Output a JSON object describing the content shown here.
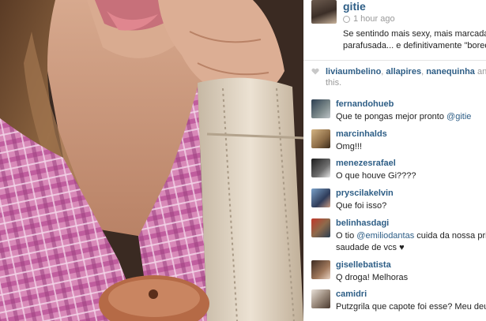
{
  "post": {
    "username": "gitie",
    "time": "1 hour ago",
    "caption_lines": [
      "Se sentindo mais sexy, mais marcada",
      "parafusada... e definitivamente \"bored"
    ]
  },
  "likes": {
    "users": [
      "liviaumbelino",
      "allapires",
      "nanequinha"
    ],
    "separators": [
      ", ",
      ", ",
      " and"
    ],
    "suffix": "this."
  },
  "comments": [
    {
      "username": "fernandohueb",
      "text": "Que te pongas mejor pronto ",
      "mention": "@gitie",
      "text_after": ""
    },
    {
      "username": "marcinhalds",
      "text": "Omg!!!",
      "mention": "",
      "text_after": ""
    },
    {
      "username": "menezesrafael",
      "text": "O que houve Gi????",
      "mention": "",
      "text_after": ""
    },
    {
      "username": "pryscilakelvin",
      "text": "Que foi isso?",
      "mention": "",
      "text_after": ""
    },
    {
      "username": "belinhasdagi",
      "text": "O tio ",
      "mention": "@emiliodantas",
      "text_after": " cuida da nossa prin",
      "text_line2": "saudade de vcs ♥"
    },
    {
      "username": "gisellebatista",
      "text": "Q droga! Melhoras",
      "mention": "",
      "text_after": ""
    },
    {
      "username": "camidri",
      "text": "Putzgrila que capote foi esse? Meu deus",
      "mention": "",
      "text_after": ""
    }
  ]
}
